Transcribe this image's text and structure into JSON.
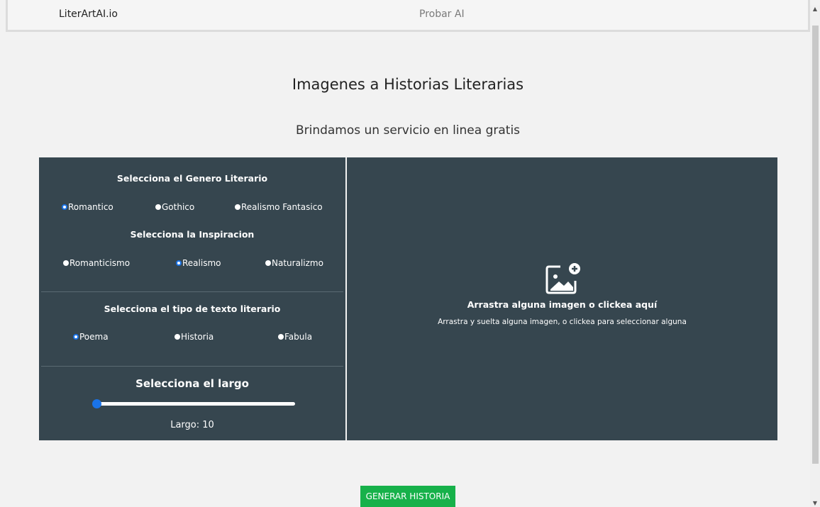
{
  "navbar": {
    "brand": "LiterArtAI.io",
    "link": "Probar AI"
  },
  "hero": {
    "title": "Imagenes a Historias Literarias",
    "subtitle": "Brindamos un servicio en linea gratis"
  },
  "form": {
    "genero": {
      "title": "Selecciona el Genero Literario",
      "options": [
        "Romantico",
        "Gothico",
        "Realismo Fantasico"
      ],
      "selected": "Romantico"
    },
    "inspiracion": {
      "title": "Selecciona la Inspiracion",
      "options": [
        "Romanticismo",
        "Realismo",
        "Naturalizmo"
      ],
      "selected": "Realismo"
    },
    "tipo": {
      "title": "Selecciona el tipo de texto literario",
      "options": [
        "Poema",
        "Historia",
        "Fabula"
      ],
      "selected": "Poema"
    },
    "largo": {
      "title": "Selecciona el largo",
      "label": "Largo: 10",
      "value": 10
    }
  },
  "dropzone": {
    "icon": "add-image-icon",
    "title": "Arrastra alguna imagen o clickea aquí",
    "subtitle": "Arrastra y suelta alguna imagen, o clickea para seleccionar alguna"
  },
  "generate_button": "GENERAR HISTORIA",
  "colors": {
    "panel": "#36464f",
    "accent": "#1a73e8",
    "button": "#17b14a"
  }
}
